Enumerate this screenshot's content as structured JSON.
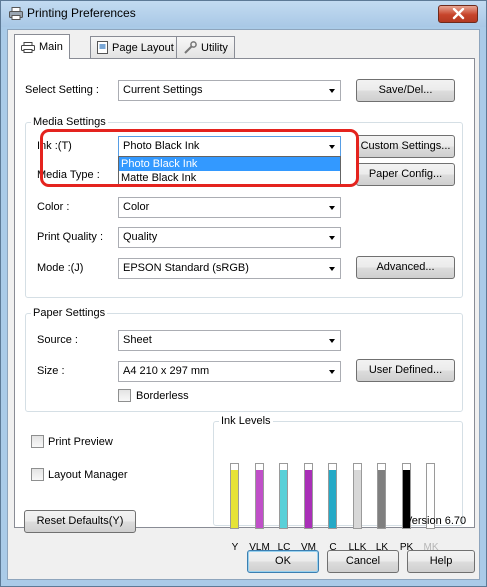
{
  "window": {
    "title": "Printing Preferences"
  },
  "tabs": [
    {
      "label": "Main",
      "icon": "printer-icon"
    },
    {
      "label": "Page Layout",
      "icon": "page-icon"
    },
    {
      "label": "Utility",
      "icon": "wrench-icon"
    }
  ],
  "select_setting": {
    "label": "Select Setting :",
    "value": "Current Settings",
    "button": "Save/Del..."
  },
  "media_settings": {
    "group_label": "Media Settings",
    "ink": {
      "label": "Ink :(T)",
      "value": "Photo Black Ink",
      "options": [
        "Photo Black Ink",
        "Matte Black Ink"
      ]
    },
    "custom_button": "Custom Settings...",
    "media_type_label": "Media Type :",
    "paper_config_button": "Paper Config...",
    "color": {
      "label": "Color :",
      "value": "Color"
    },
    "print_quality": {
      "label": "Print Quality :",
      "value": "Quality"
    },
    "mode": {
      "label": "Mode :(J)",
      "value": "EPSON Standard (sRGB)"
    },
    "advanced_button": "Advanced..."
  },
  "paper_settings": {
    "group_label": "Paper Settings",
    "source": {
      "label": "Source :",
      "value": "Sheet"
    },
    "size": {
      "label": "Size :",
      "value": "A4 210 x 297 mm"
    },
    "user_defined_button": "User Defined...",
    "borderless_label": "Borderless"
  },
  "options": {
    "print_preview": "Print Preview",
    "layout_manager": "Layout Manager"
  },
  "ink_levels": {
    "group_label": "Ink Levels",
    "inks": [
      {
        "name": "Y",
        "color": "#e6e337",
        "level": 0.88,
        "available": true
      },
      {
        "name": "VLM",
        "color": "#c050c8",
        "level": 0.88,
        "available": true
      },
      {
        "name": "LC",
        "color": "#59d0d8",
        "level": 0.88,
        "available": true
      },
      {
        "name": "VM",
        "color": "#a92fb7",
        "level": 0.88,
        "available": true
      },
      {
        "name": "C",
        "color": "#25a9c6",
        "level": 0.88,
        "available": true
      },
      {
        "name": "LLK",
        "color": "#d8d8d8",
        "level": 0.88,
        "available": true
      },
      {
        "name": "LK",
        "color": "#7f7f7f",
        "level": 0.88,
        "available": true
      },
      {
        "name": "PK",
        "color": "#000000",
        "level": 0.88,
        "available": true
      },
      {
        "name": "MK",
        "color": "#ffffff",
        "level": 0.0,
        "available": false
      }
    ]
  },
  "footer": {
    "reset_button": "Reset Defaults(Y)",
    "version": "Version 6.70"
  },
  "dialog_buttons": {
    "ok": "OK",
    "cancel": "Cancel",
    "help": "Help"
  }
}
